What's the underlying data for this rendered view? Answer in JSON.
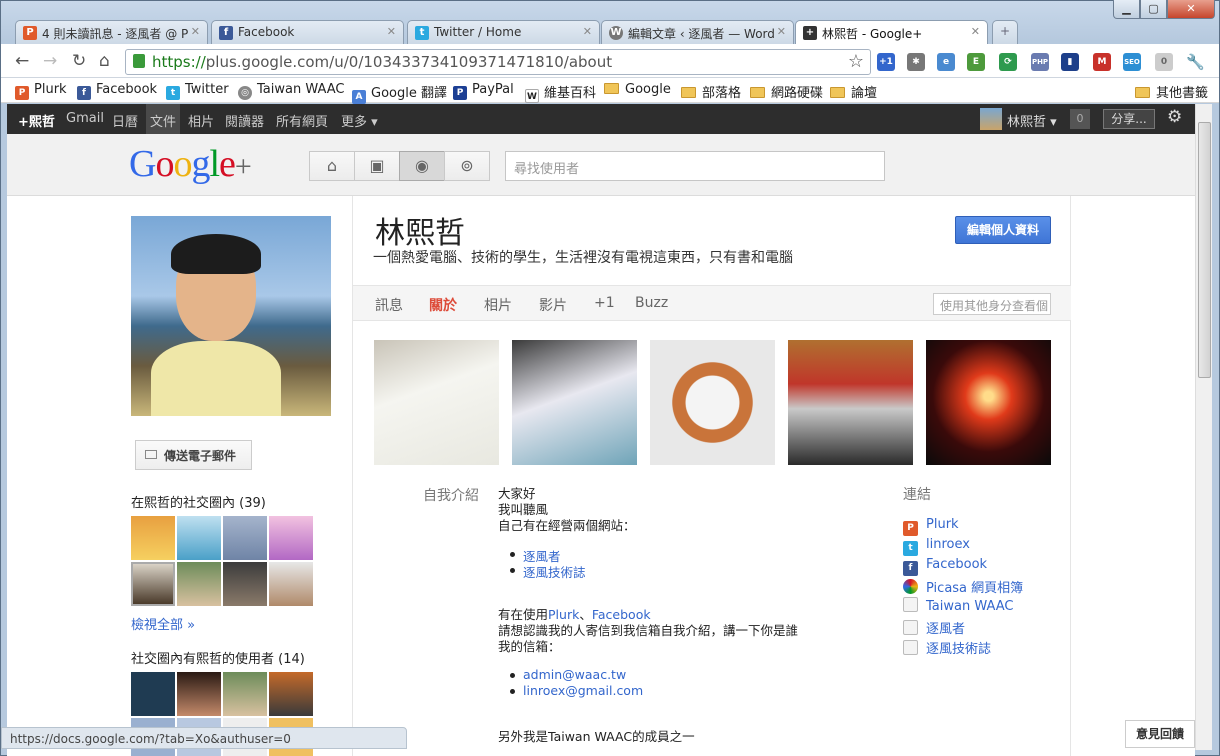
{
  "browser": {
    "tabs": [
      {
        "label": "4 則未讀訊息 - 逐風者 @ P",
        "favicon": "P",
        "color": "#e05a2b"
      },
      {
        "label": "Facebook",
        "favicon": "f",
        "color": "#3b5998"
      },
      {
        "label": "Twitter / Home",
        "favicon": "t",
        "color": "#2aa9e0"
      },
      {
        "label": "編輯文章 ‹ 逐風者 — Word",
        "favicon": "W",
        "color": "#777777"
      },
      {
        "label": "林熙哲 - Google+",
        "favicon": "+",
        "color": "#333333"
      }
    ],
    "url_scheme": "https://",
    "url_rest": "plus.google.com/u/0/103433734109371471810/about",
    "extensions": [
      "+1",
      "PHP",
      "SEO",
      "0"
    ],
    "bookmarks": [
      {
        "label": "Plurk",
        "icon": "plurk-icon"
      },
      {
        "label": "Facebook",
        "icon": "facebook-icon"
      },
      {
        "label": "Twitter",
        "icon": "twitter-icon"
      },
      {
        "label": "Taiwan WAAC",
        "icon": "globe-icon"
      },
      {
        "label": "Google 翻譯",
        "icon": "translate-icon"
      },
      {
        "label": "PayPal",
        "icon": "paypal-icon"
      },
      {
        "label": "維基百科",
        "icon": "wikipedia-icon"
      },
      {
        "label": "Google",
        "icon": "folder-icon"
      },
      {
        "label": "部落格",
        "icon": "folder-icon"
      },
      {
        "label": "網路硬碟",
        "icon": "folder-icon"
      },
      {
        "label": "論壇",
        "icon": "folder-icon"
      }
    ],
    "other_bookmarks": "其他書籤",
    "status_url": "https://docs.google.com/?tab=Xo&authuser=0"
  },
  "gbar": {
    "items": [
      "+熙哲",
      "Gmail",
      "日曆",
      "文件",
      "相片",
      "閱讀器",
      "所有網頁",
      "更多 ▾"
    ],
    "user": "林熙哲 ▾",
    "notif_count": "0",
    "share": "分享..."
  },
  "header": {
    "logo": "Google+",
    "search_placeholder": "尋找使用者"
  },
  "sidebar": {
    "email_button": "傳送電子郵件",
    "circles_title": "在熙哲的社交圈內 (39)",
    "view_all": "檢視全部 »",
    "in_circles_title": "社交圈內有熙哲的使用者 (14)"
  },
  "profile": {
    "name": "林熙哲",
    "tagline": "一個熱愛電腦、技術的學生，生活裡沒有電視這東西，只有書和電腦",
    "edit_button": "編輯個人資料",
    "tabs": [
      "訊息",
      "關於",
      "相片",
      "影片",
      "+1",
      "Buzz"
    ],
    "active_tab": "關於",
    "view_as_placeholder": "使用其他身分查看個",
    "intro_label": "自我介紹",
    "intro": {
      "l1": "大家好",
      "l2": "我叫聽風",
      "l3": "自己有在經營兩個網站：",
      "site1": "逐風者",
      "site2": "逐風技術誌",
      "using_prefix": "有在使用",
      "using_a": "Plurk",
      "using_sep": "、",
      "using_b": "Facebook",
      "contact1": "請想認識我的人寄信到我信箱自我介紹，講一下你是誰",
      "contact2": "我的信箱：",
      "email1": "admin@waac.tw",
      "email2": "linroex@gmail.com",
      "extra": "另外我是Taiwan WAAC的成員之一"
    },
    "links_label": "連結",
    "links": [
      "Plurk",
      "linroex",
      "Facebook",
      "Picasa 網頁相簿",
      "Taiwan WAAC",
      "逐風者",
      "逐風技術誌"
    ]
  },
  "feedback": "意見回饋"
}
